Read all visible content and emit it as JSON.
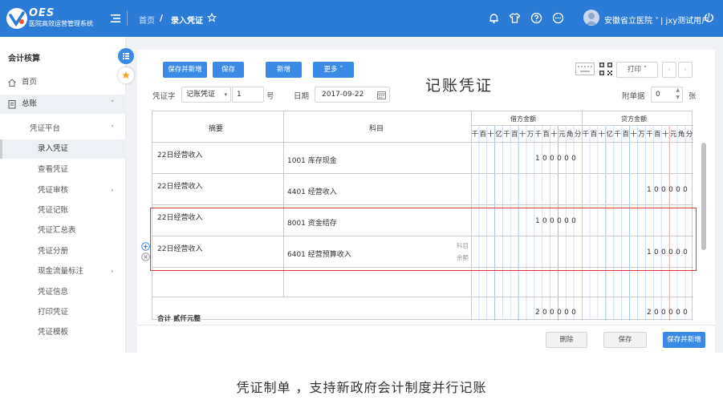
{
  "header": {
    "brand": "OES",
    "brand_sub": "医院高效运营管理系统",
    "breadcrumb_home": "首页",
    "breadcrumb_sep": "/",
    "breadcrumb_current": "录入凭证",
    "hospital": "安徽省立医院 ˅",
    "user": "| jxy测试用户",
    "accent": "#2c7bd6"
  },
  "sidebar": {
    "title": "会计核算",
    "items": [
      {
        "label": "首页",
        "icon": "home-icon"
      },
      {
        "label": "总账",
        "icon": "ledger-icon",
        "arrow": "˅"
      },
      {
        "label": "凭证平台",
        "arrow": "˅"
      },
      {
        "label": "录入凭证"
      },
      {
        "label": "查看凭证"
      },
      {
        "label": "凭证审核",
        "arrow": "›"
      },
      {
        "label": "凭证记账"
      },
      {
        "label": "凭证汇总表"
      },
      {
        "label": "凭证分册"
      },
      {
        "label": "现金流量标注",
        "arrow": "›"
      },
      {
        "label": "凭证信息"
      },
      {
        "label": "打印凭证"
      },
      {
        "label": "凭证模板"
      }
    ]
  },
  "toolbar": {
    "save_new": "保存并新增",
    "save": "保存",
    "new": "新增",
    "more": "更多 ˅",
    "print": "打印 ˅",
    "prev": "‹",
    "next": "›"
  },
  "form": {
    "voucher_word_label": "凭证字",
    "voucher_word_value": "记账凭证",
    "number_value": "1",
    "number_unit": "号",
    "date_label": "日期",
    "date_value": "2017-09-22",
    "title": "记账凭证",
    "attach_label": "附单据",
    "attach_value": "0",
    "attach_unit": "张"
  },
  "table": {
    "col_summary": "摘要",
    "col_account": "科目",
    "col_debit": "借方金额",
    "col_credit": "贷方金额",
    "digit_headers": [
      "千",
      "百",
      "十",
      "亿",
      "千",
      "百",
      "十",
      "万",
      "千",
      "百",
      "十",
      "元",
      "角",
      "分"
    ],
    "rows": [
      {
        "summary": "22日经营收入",
        "account": "1001 库存现金",
        "debit": "100000",
        "credit": ""
      },
      {
        "summary": "22日经营收入",
        "account": "4401 经营收入",
        "debit": "",
        "credit": "100000"
      },
      {
        "summary": "22日经营收入",
        "account": "8001 资金结存",
        "debit": "100000",
        "credit": ""
      },
      {
        "summary": "22日经营收入",
        "account": "6401 经营预算收入",
        "debit": "",
        "credit": "100000",
        "hint1": "科目",
        "hint2": "余额"
      }
    ],
    "total_label": "合计  贰仟元整",
    "total_debit": "200000",
    "total_credit": "200000"
  },
  "footer": {
    "delete": "删除",
    "save": "保存",
    "save_new": "保存并新增"
  },
  "caption": "凭证制单 ，支持新政府会计制度并行记账"
}
